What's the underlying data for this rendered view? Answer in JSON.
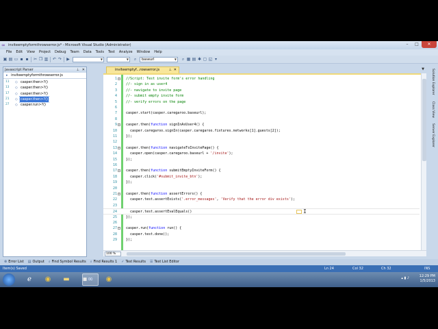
{
  "window": {
    "title": "inviteemptyformthrowserror.js* - Microsoft Visual Studio (Administrator)",
    "minimize": "–",
    "maximize": "□",
    "close": "✕"
  },
  "menu": [
    "File",
    "Edit",
    "View",
    "Project",
    "Debug",
    "Team",
    "Data",
    "Tools",
    "Test",
    "Analyze",
    "Window",
    "Help"
  ],
  "toolbar": {
    "find_combo": "baseurl"
  },
  "parser": {
    "title": "Javascript Parser",
    "file": "inviteemptyformthrowserror.js",
    "items": [
      {
        "line": "11",
        "label": "casper.then>?()",
        "selected": false
      },
      {
        "line": "13",
        "label": "casper.then>?()",
        "selected": false
      },
      {
        "line": "17",
        "label": "casper.then>?()",
        "selected": false
      },
      {
        "line": "21",
        "label": "casper.then>?()",
        "selected": true
      },
      {
        "line": "27",
        "label": "casper.run>?()",
        "selected": false
      }
    ]
  },
  "editor": {
    "tab_label": "inviteemptyf...rowserror.js",
    "zoom": "100 %",
    "lines": [
      {
        "n": "1",
        "fold": "⊟",
        "html": "<span class=\"c-com\">//Script: Test invite form's error handling</span>"
      },
      {
        "n": "2",
        "fold": "",
        "html": "<span class=\"c-com\">//- sign in as user4</span>"
      },
      {
        "n": "3",
        "fold": "",
        "html": "<span class=\"c-com\">//- navigate to invite page</span>"
      },
      {
        "n": "4",
        "fold": "",
        "html": "<span class=\"c-com\">//- submit empty invite form</span>"
      },
      {
        "n": "5",
        "fold": "",
        "html": "<span class=\"c-com\">//- verify errors on the page</span>"
      },
      {
        "n": "6",
        "fold": "",
        "html": ""
      },
      {
        "n": "7",
        "fold": "",
        "html": "casper.start(casper.caregaroo.baseurl);"
      },
      {
        "n": "8",
        "fold": "",
        "html": ""
      },
      {
        "n": "9",
        "fold": "⊟",
        "html": "casper.then(<span class=\"c-kw\">function</span> signInAsUser4() {"
      },
      {
        "n": "10",
        "fold": "",
        "html": "  casper.caregaroo.signIn(casper.caregaroo.fixtures.networks[1].guests[2]);"
      },
      {
        "n": "11",
        "fold": "",
        "html": "});"
      },
      {
        "n": "12",
        "fold": "",
        "html": ""
      },
      {
        "n": "13",
        "fold": "⊟",
        "html": "casper.then(<span class=\"c-kw\">function</span> navigateToInvitePage() {"
      },
      {
        "n": "14",
        "fold": "",
        "html": "  casper.open(casper.caregaroo.baseurl + <span class=\"c-str\">'/invite'</span>);"
      },
      {
        "n": "15",
        "fold": "",
        "html": "});"
      },
      {
        "n": "16",
        "fold": "",
        "html": ""
      },
      {
        "n": "17",
        "fold": "⊟",
        "html": "casper.then(<span class=\"c-kw\">function</span> submitEmptyInviteForm() {"
      },
      {
        "n": "18",
        "fold": "",
        "html": "  casper.click(<span class=\"c-str\">'#submit_invite_btn'</span>);"
      },
      {
        "n": "19",
        "fold": "",
        "html": "});"
      },
      {
        "n": "20",
        "fold": "",
        "html": ""
      },
      {
        "n": "21",
        "fold": "⊟",
        "html": "casper.then(<span class=\"c-kw\">function</span> assertErrors() {"
      },
      {
        "n": "22",
        "fold": "",
        "html": "  casper.test.assertExists(<span class=\"c-str\">'.error_messages'</span>, <span class=\"c-str\">'Verify that the error div exists'</span>);"
      },
      {
        "n": "23",
        "fold": "",
        "html": ""
      },
      {
        "n": "24",
        "fold": "",
        "html": "  casper.test.assertEvalEquals()"
      },
      {
        "n": "25",
        "fold": "",
        "html": "});"
      },
      {
        "n": "26",
        "fold": "",
        "html": ""
      },
      {
        "n": "27",
        "fold": "⊟",
        "html": "casper.run(<span class=\"c-kw\">function</span> run() {"
      },
      {
        "n": "28",
        "fold": "",
        "html": "  casper.test.done();"
      },
      {
        "n": "29",
        "fold": "",
        "html": "});"
      }
    ],
    "current_line": 24
  },
  "right_tabs": [
    "Solution Explorer",
    "Class View",
    "Server Explorer"
  ],
  "bottom_tabs": [
    {
      "icon": "error-list-icon",
      "glyph": "⊗",
      "label": "Error List"
    },
    {
      "icon": "output-icon",
      "glyph": "▤",
      "label": "Output"
    },
    {
      "icon": "find-symbol-icon",
      "glyph": "⌕",
      "label": "Find Symbol Results"
    },
    {
      "icon": "find-results-icon",
      "glyph": "⌕",
      "label": "Find Results 1"
    },
    {
      "icon": "test-results-icon",
      "glyph": "✓",
      "label": "Test Results"
    },
    {
      "icon": "test-list-icon",
      "glyph": "☰",
      "label": "Test List Editor"
    }
  ],
  "status": {
    "message": "Item(s) Saved",
    "ln": "Ln 24",
    "col": "Col 32",
    "ch": "Ch 32",
    "mode": "INS"
  },
  "taskbar": {
    "time": "12:29 PM",
    "date": "1/5/2013"
  },
  "colors": {
    "status_blue": "#3a6fb5",
    "tab_yellow": "#f8e69a",
    "selection": "#3875d7"
  }
}
